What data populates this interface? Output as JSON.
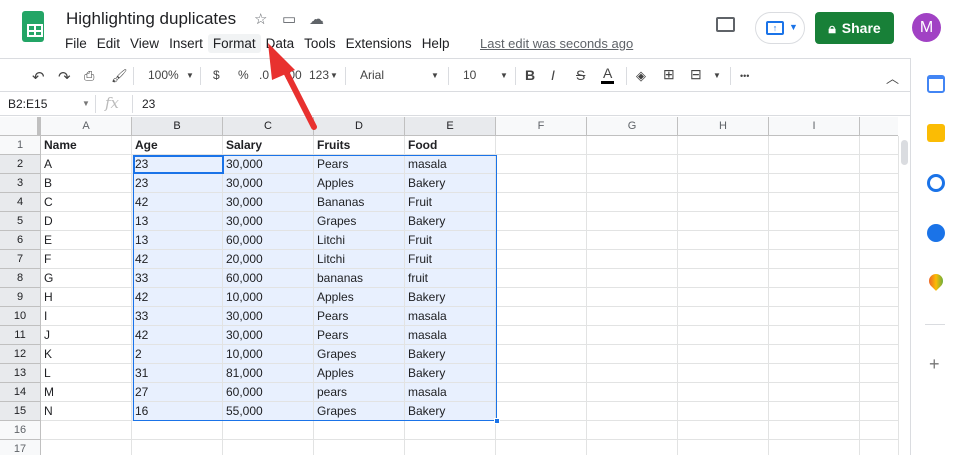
{
  "doc": {
    "title": "Highlighting duplicates",
    "last_edit": "Last edit was seconds ago"
  },
  "menu": [
    "File",
    "Edit",
    "View",
    "Insert",
    "Format",
    "Data",
    "Tools",
    "Extensions",
    "Help"
  ],
  "header": {
    "share": "Share",
    "avatar": "M"
  },
  "toolbar": {
    "zoom": "100%",
    "currency": "$",
    "percent": "%",
    "dec_less": ".0",
    "dec_more": ".00",
    "format": "123",
    "font": "Arial",
    "size": "10",
    "bold": "B",
    "italic": "I",
    "strike": "S",
    "color": "A",
    "more": "•••"
  },
  "formula": {
    "range": "B2:E15",
    "fx": "fx",
    "value": "23"
  },
  "columns": [
    "A",
    "B",
    "C",
    "D",
    "E",
    "F",
    "G",
    "H",
    "I"
  ],
  "rows": [
    [
      "Name",
      "Age",
      "Salary",
      "Fruits",
      "Food"
    ],
    [
      "A",
      "23",
      "30,000",
      "Pears",
      "masala"
    ],
    [
      "B",
      "23",
      "30,000",
      "Apples",
      "Bakery"
    ],
    [
      "C",
      "42",
      "30,000",
      "Bananas",
      "Fruit"
    ],
    [
      "D",
      "13",
      "30,000",
      "Grapes",
      "Bakery"
    ],
    [
      "E",
      "13",
      "60,000",
      "Litchi",
      "Fruit"
    ],
    [
      "F",
      "42",
      "20,000",
      "Litchi",
      "Fruit"
    ],
    [
      "G",
      "33",
      "60,000",
      "bananas",
      "fruit"
    ],
    [
      "H",
      "42",
      "10,000",
      "Apples",
      "Bakery"
    ],
    [
      "I",
      "33",
      "30,000",
      "Pears",
      "masala"
    ],
    [
      "J",
      "42",
      "30,000",
      "Pears",
      "masala"
    ],
    [
      "K",
      "2",
      "10,000",
      "Grapes",
      "Bakery"
    ],
    [
      "L",
      "31",
      "81,000",
      "Apples",
      "Bakery"
    ],
    [
      "M",
      "27",
      "60,000",
      "pears",
      "masala"
    ],
    [
      "N",
      "16",
      "55,000",
      "Grapes",
      "Bakery"
    ],
    [
      "",
      "",
      "",
      "",
      ""
    ],
    [
      "",
      "",
      "",
      "",
      ""
    ]
  ],
  "colors": {
    "accent": "#1a73e8",
    "share": "#188038",
    "selection": "#e8f0fe",
    "arrow": "#e8312f"
  }
}
